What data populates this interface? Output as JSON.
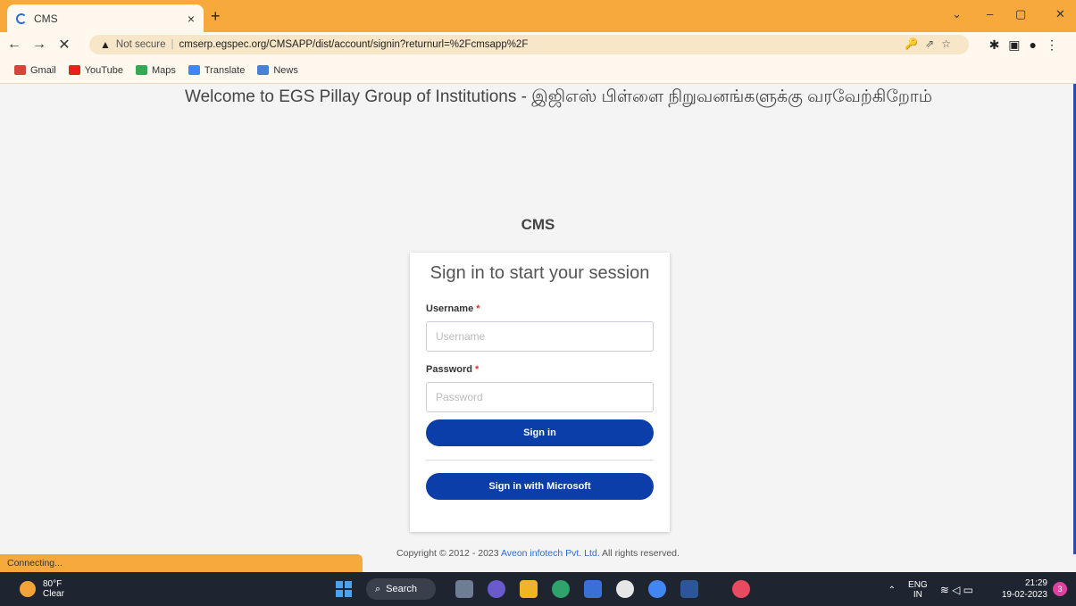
{
  "browser": {
    "tab_title": "CMS",
    "tab_close": "×",
    "new_tab": "+",
    "window_controls": [
      "⌄",
      "–",
      "▢",
      "✕"
    ],
    "nav": [
      "←",
      "→",
      "✕"
    ],
    "security_icon": "▲",
    "not_secure": "Not secure",
    "url": "cmserp.egspec.org/CMSAPP/dist/account/signin?returnurl=%2Fcmsapp%2F",
    "bookmarks": [
      {
        "label": "Gmail",
        "color": "#d44638"
      },
      {
        "label": "YouTube",
        "color": "#e62117"
      },
      {
        "label": "Maps",
        "color": "#34a853"
      },
      {
        "label": "Translate",
        "color": "#4285f4"
      },
      {
        "label": "News",
        "color": "#4a7fd8"
      }
    ]
  },
  "page": {
    "welcome": "Welcome to EGS Pillay Group of Institutions - இஜிஎஸ் பிள்ளை நிறுவனங்களுக்கு வரவேற்கிறோம்",
    "brand": "CMS",
    "form": {
      "title": "Sign in to start your session",
      "username_label": "Username",
      "username_placeholder": "Username",
      "password_label": "Password",
      "password_placeholder": "Password",
      "required_mark": "*",
      "signin_button": "Sign in",
      "microsoft_button": "Sign in with Microsoft"
    },
    "copyright_prefix": "Copyright © 2012 - 2023 ",
    "copyright_company": "Aveon infotech Pvt. Ltd.",
    "copyright_suffix": " All rights reserved."
  },
  "status": "Connecting...",
  "taskbar": {
    "temperature": "80°F",
    "weather": "Clear",
    "search": "Search",
    "lang": "ENG",
    "region": "IN",
    "time": "21:29",
    "date": "19-02-2023",
    "notifications": "3"
  }
}
